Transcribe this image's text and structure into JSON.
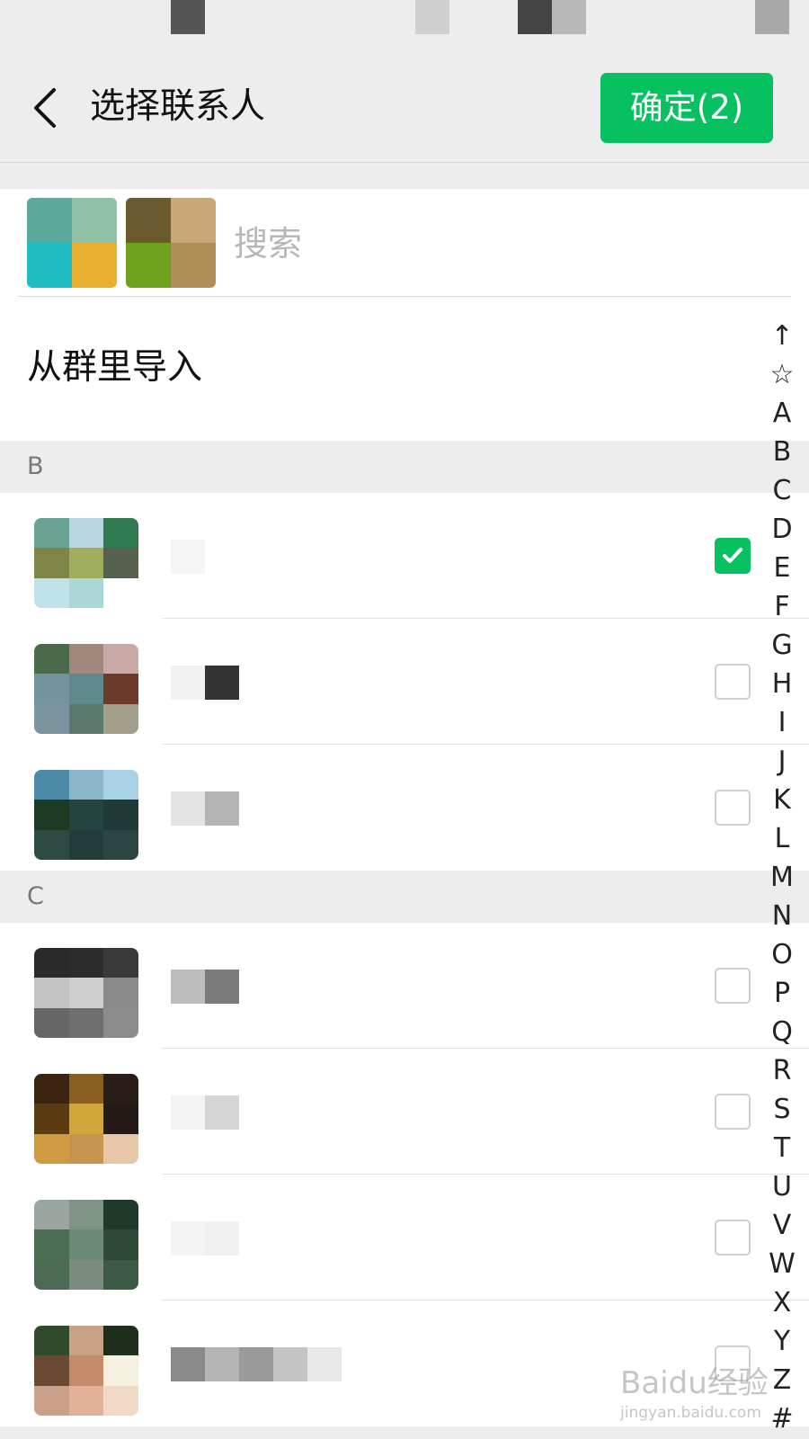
{
  "header": {
    "title": "选择联系人",
    "confirm_label": "确定(2)"
  },
  "search": {
    "placeholder": "搜索"
  },
  "import": {
    "label": "从群里导入"
  },
  "sections": [
    {
      "letter": "B"
    },
    {
      "letter": "C"
    }
  ],
  "contacts": [
    {
      "section": "B",
      "checked": true,
      "name_visible": false
    },
    {
      "section": "B",
      "checked": false,
      "name_visible": false
    },
    {
      "section": "B",
      "checked": false,
      "name_visible": false
    },
    {
      "section": "C",
      "checked": false,
      "name_visible": false
    },
    {
      "section": "C",
      "checked": false,
      "name_visible": false
    },
    {
      "section": "C",
      "checked": false,
      "name_visible": false
    },
    {
      "section": "C",
      "checked": false,
      "name_visible": false
    }
  ],
  "alpha_index": [
    "↑",
    "☆",
    "A",
    "B",
    "C",
    "D",
    "E",
    "F",
    "G",
    "H",
    "I",
    "J",
    "K",
    "L",
    "M",
    "N",
    "O",
    "P",
    "Q",
    "R",
    "S",
    "T",
    "U",
    "V",
    "W",
    "X",
    "Y",
    "Z",
    "#"
  ],
  "watermark": {
    "brand": "Baidu经验",
    "url": "jingyan.baidu.com"
  },
  "colors": {
    "accent": "#07c160",
    "background": "#ededed",
    "row": "#ffffff",
    "section_text": "#777777",
    "placeholder": "#b7b7b7"
  },
  "icons": {
    "back": "chevron-left-icon",
    "check": "checkmark-icon"
  }
}
